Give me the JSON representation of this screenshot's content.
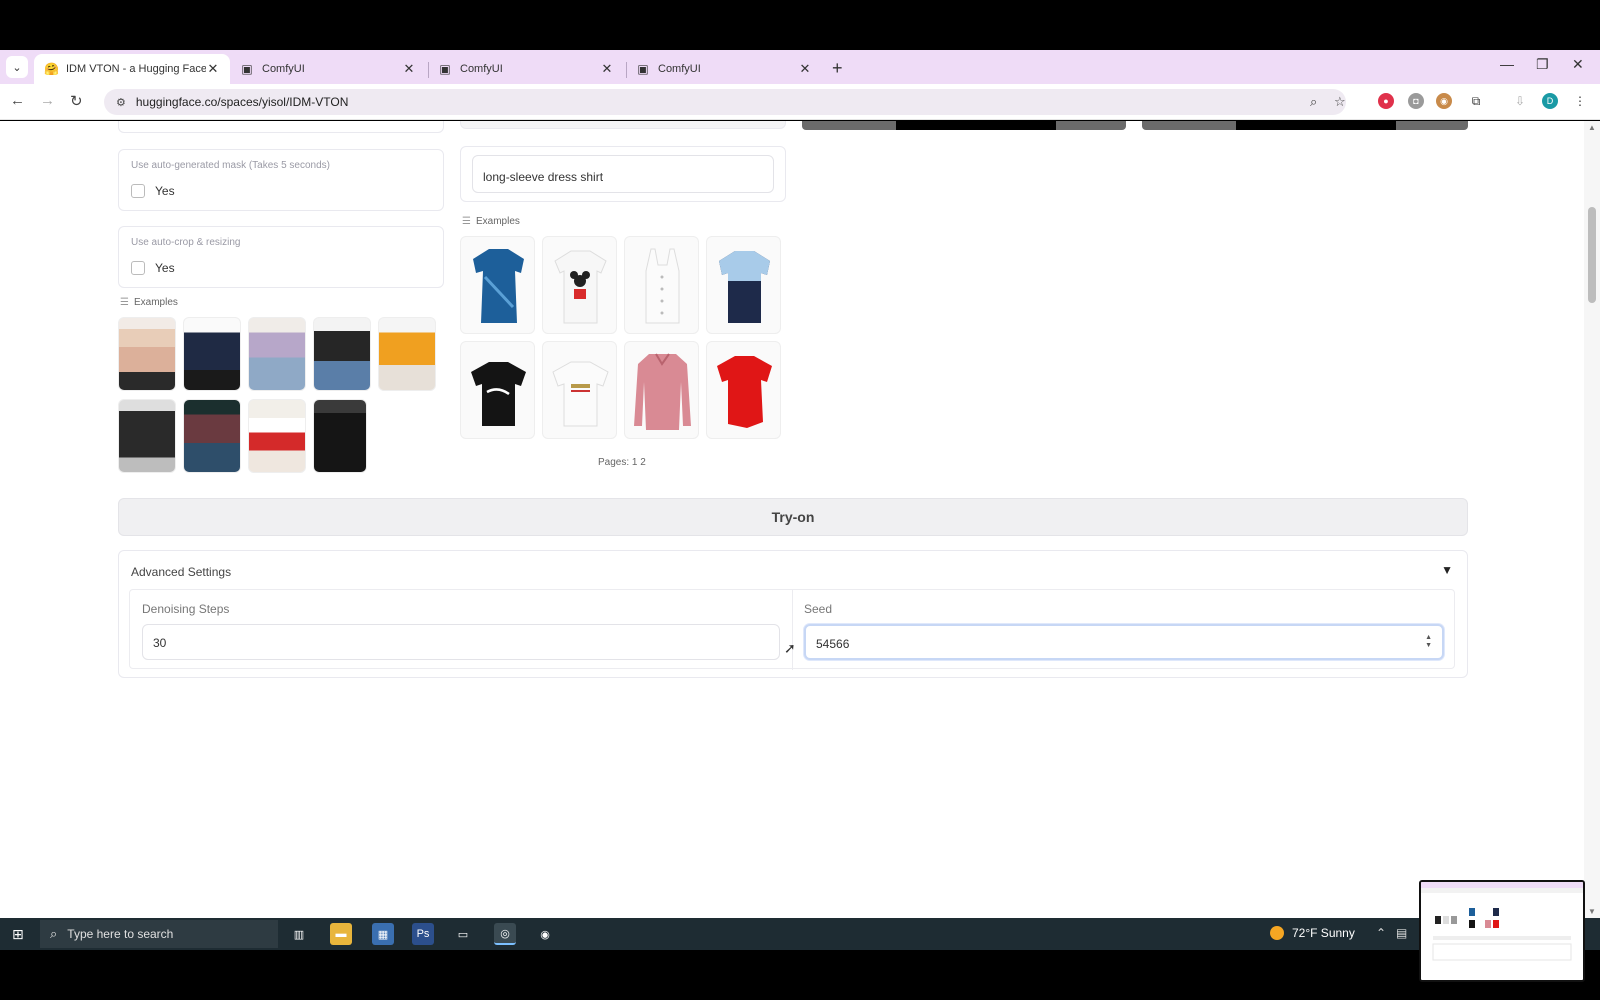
{
  "browser": {
    "tabs": [
      {
        "title": "IDM VTON - a Hugging Face Sp",
        "active": true
      },
      {
        "title": "ComfyUI",
        "active": false
      },
      {
        "title": "ComfyUI",
        "active": false
      },
      {
        "title": "ComfyUI",
        "active": false
      }
    ],
    "url": "huggingface.co/spaces/yisol/IDM-VTON",
    "profile_initial": "D"
  },
  "left_panel": {
    "auto_mask": {
      "label": "Use auto-generated mask (Takes 5 seconds)",
      "option": "Yes",
      "checked": false
    },
    "auto_crop": {
      "label": "Use auto-crop & resizing",
      "option": "Yes",
      "checked": false
    },
    "examples_label": "Examples"
  },
  "right_panel": {
    "garment_description": "long-sleeve dress shirt",
    "examples_label": "Examples",
    "pages_label": "Pages: 1 2"
  },
  "try_on_label": "Try-on",
  "advanced": {
    "title": "Advanced Settings",
    "caret": "▼",
    "denoising_label": "Denoising Steps",
    "denoising_value": "30",
    "seed_label": "Seed",
    "seed_value": "54566"
  },
  "taskbar": {
    "search_placeholder": "Type here to search",
    "weather": "72°F  Sunny"
  },
  "colors": {
    "tabstrip": "#efdcf7",
    "taskbar": "#1e2c33",
    "accent_focus": "#c7d7f5"
  }
}
